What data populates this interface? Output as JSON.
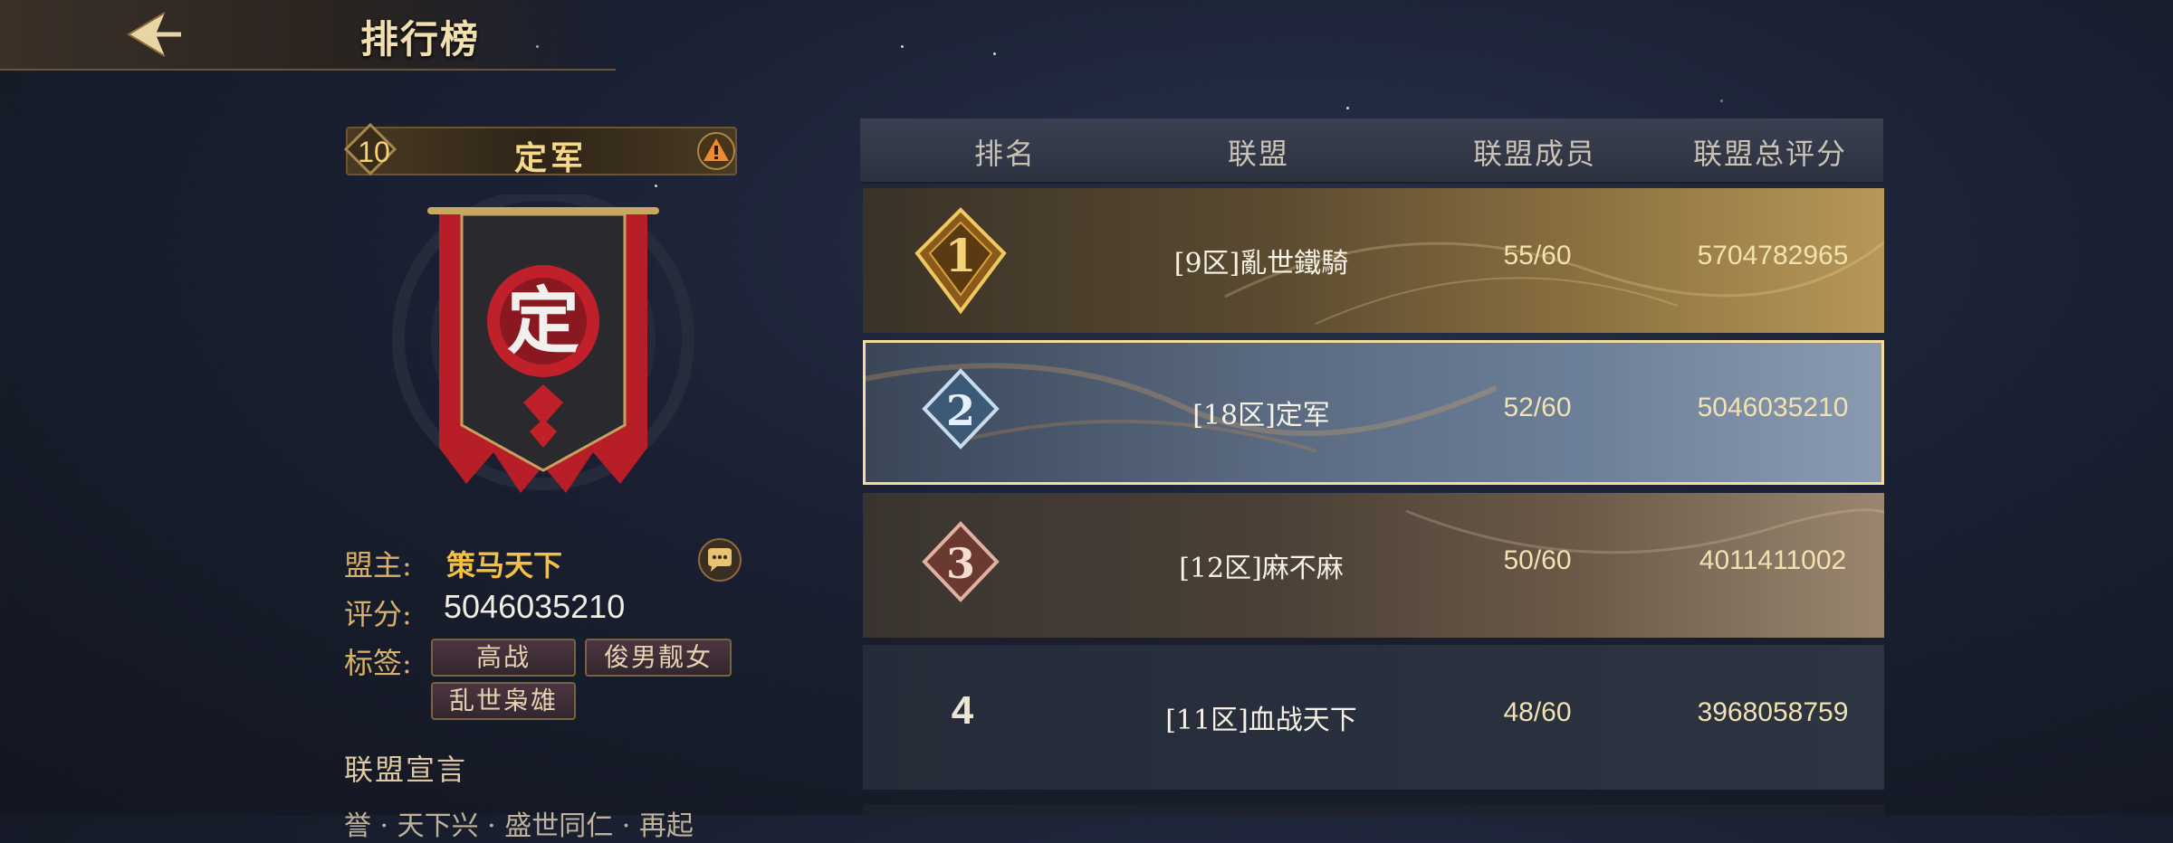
{
  "header": {
    "title": "排行榜"
  },
  "alliance": {
    "rank": "10",
    "name": "定军",
    "emblem_char": "定",
    "leader_label": "盟主:",
    "leader_name": "策马天下",
    "score_label": "评分:",
    "score": "5046035210",
    "tags_label": "标签:",
    "tags": [
      "高战",
      "俊男靓女",
      "乱世枭雄"
    ],
    "declaration_title": "联盟宣言",
    "declaration_text": "誉 · 天下兴 · 盛世同仁 · 再起"
  },
  "table": {
    "headers": [
      "排名",
      "联盟",
      "联盟成员",
      "联盟总评分"
    ],
    "rows": [
      {
        "rank": "1",
        "name": "[9区]亂世鐵騎",
        "members": "55/60",
        "score": "5704782965"
      },
      {
        "rank": "2",
        "name": "[18区]定军",
        "members": "52/60",
        "score": "5046035210"
      },
      {
        "rank": "3",
        "name": "[12区]麻不麻",
        "members": "50/60",
        "score": "4011411002"
      },
      {
        "rank": "4",
        "name": "[11区]血战天下",
        "members": "48/60",
        "score": "3968058759"
      }
    ],
    "highlighted_rank": "2"
  },
  "colors": {
    "gold": "#f5c040",
    "highlight_border": "#f3dc9c",
    "banner_red": "#c0202a"
  },
  "icons": {
    "back": "back-arrow-icon",
    "warning": "warning-icon",
    "chat": "chat-bubble-icon"
  }
}
